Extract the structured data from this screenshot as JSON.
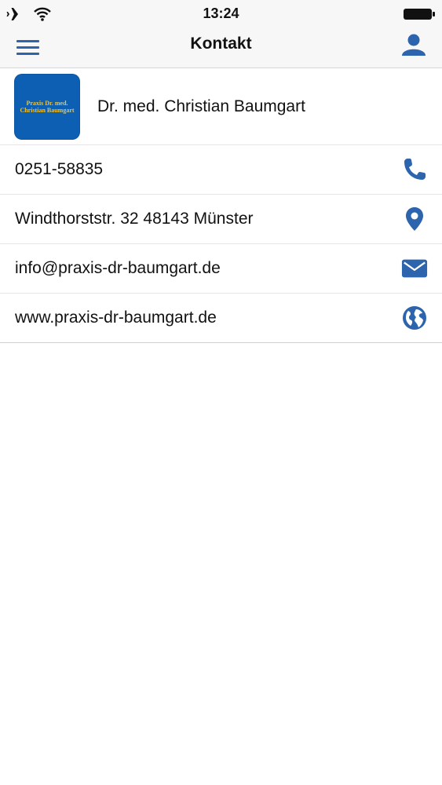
{
  "status_bar": {
    "time": "13:24",
    "icons": [
      "airplane-icon",
      "wifi-icon",
      "battery-icon"
    ]
  },
  "nav": {
    "title": "Kontakt",
    "left_icon": "menu-icon",
    "right_icon": "profile-icon"
  },
  "header": {
    "logo_lines": [
      "Praxis Dr. med.",
      "Christian Baumgart"
    ],
    "name": "Dr. med. Christian Baumgart"
  },
  "contacts": [
    {
      "text": "0251-58835",
      "icon": "phone-icon"
    },
    {
      "text": "Windthorststr. 32 48143 Münster",
      "icon": "map-pin-icon"
    },
    {
      "text": "info@praxis-dr-baumgart.de",
      "icon": "mail-icon"
    },
    {
      "text": "www.praxis-dr-baumgart.de",
      "icon": "globe-icon"
    }
  ],
  "colors": {
    "accent": "#2d64ae",
    "logo_bg": "#0d5fb4",
    "logo_text": "#f1c232",
    "bar_bg": "#f7f7f8"
  }
}
